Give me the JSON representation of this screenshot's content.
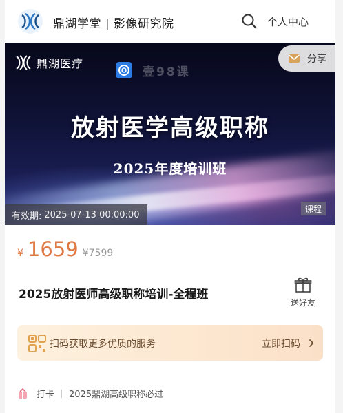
{
  "header": {
    "title": "鼎湖学堂 | 影像研究院",
    "search_icon": "search-icon",
    "personal_center": "个人中心"
  },
  "banner": {
    "brand_name": "鼎湖医疗",
    "watermark_text": "壹98课",
    "share_label": "分享",
    "title": "放射医学高级职称",
    "subtitle": "2025年度培训班",
    "validity_label": "有效期:",
    "validity_value": "2025-07-13 00:00:00",
    "course_tag": "课程"
  },
  "product": {
    "currency": "¥",
    "price": "1659",
    "original_price": "¥7599",
    "title": "2025放射医师高级职称培训-全程班",
    "gift_label": "送好友"
  },
  "scan_card": {
    "text": "扫码获取更多优质的服务",
    "action": "立即扫码",
    "icon": "scan-service-icon"
  },
  "footer_tag": {
    "label": "打卡",
    "text": "2025鼎湖高级职称必过"
  },
  "colors": {
    "accent_price": "#e07a45",
    "scan_card_bg": "#fde7d0",
    "banner_dark": "#101338"
  }
}
